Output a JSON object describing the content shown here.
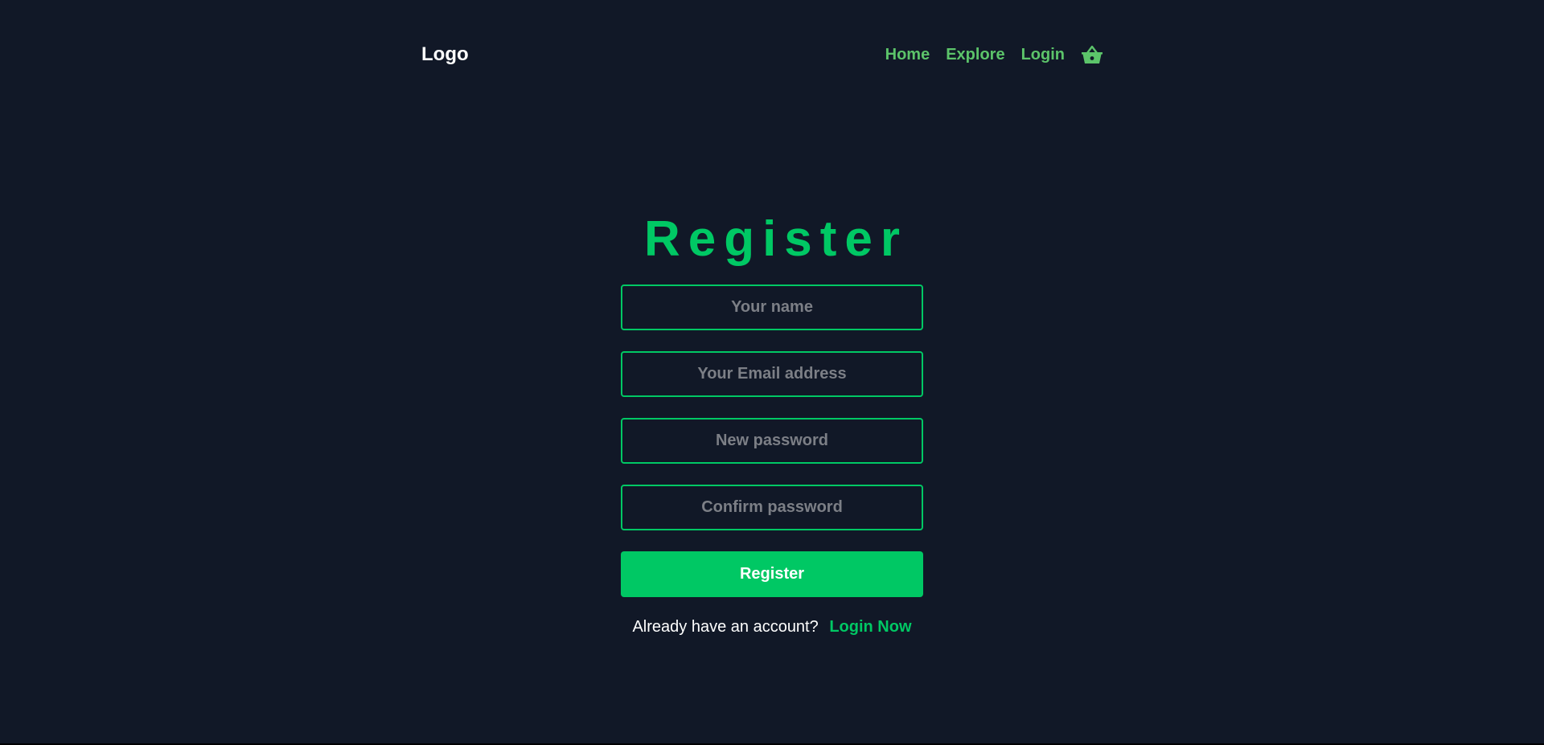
{
  "header": {
    "logo": "Logo",
    "nav": [
      "Home",
      "Explore",
      "Login"
    ],
    "cart_icon": "basket-icon"
  },
  "form": {
    "title": "Register",
    "fields": {
      "name_placeholder": "Your name",
      "email_placeholder": "Your Email address",
      "password_placeholder": "New password",
      "confirm_placeholder": "Confirm password"
    },
    "submit_label": "Register",
    "footer_text": "Already have an account?",
    "footer_link": "Login Now"
  },
  "colors": {
    "background": "#111827",
    "accent": "#00c864",
    "nav_link": "#5cc46a",
    "placeholder": "#7c7f86"
  }
}
